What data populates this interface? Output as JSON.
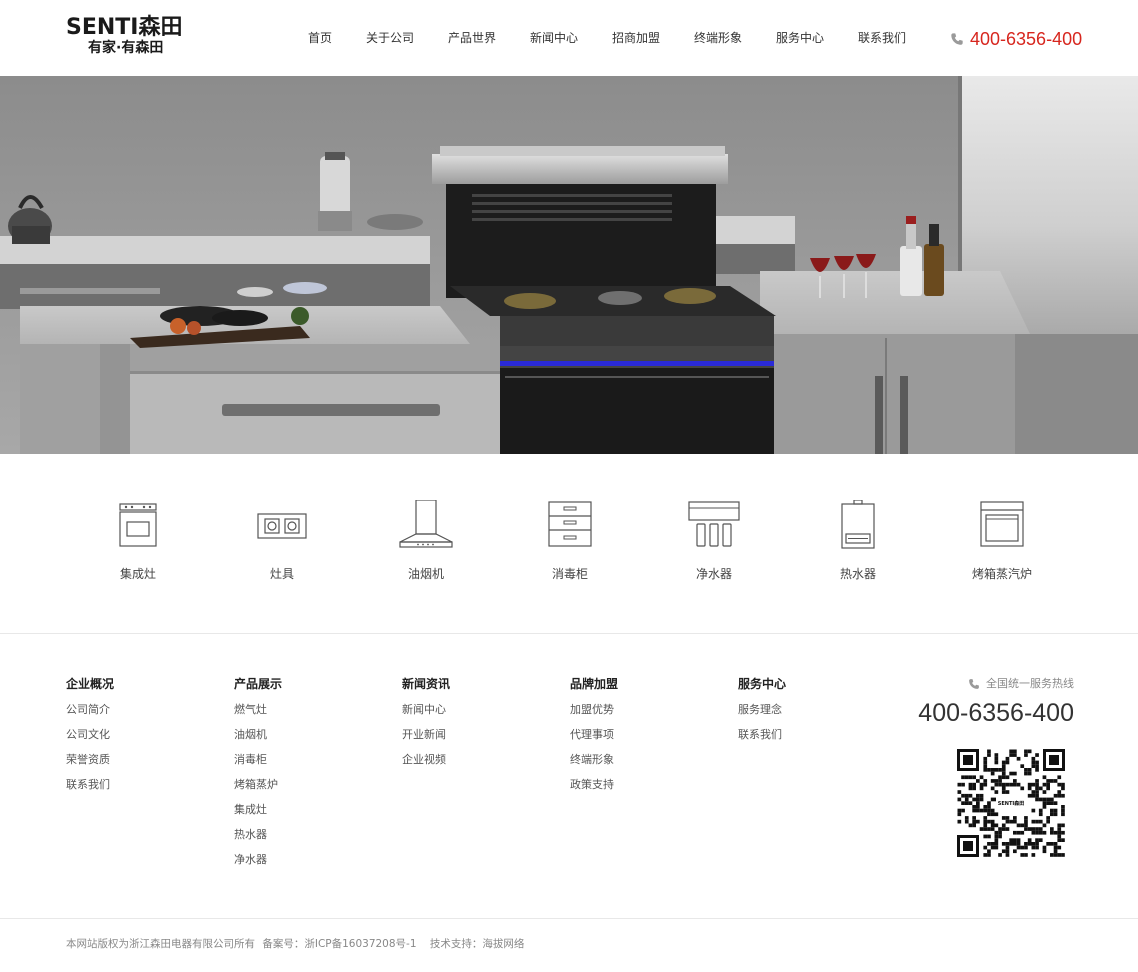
{
  "header": {
    "logo_brand": "SENTI森田",
    "logo_slogan": "有家·有森田",
    "nav": [
      "首页",
      "关于公司",
      "产品世界",
      "新闻中心",
      "招商加盟",
      "终端形象",
      "服务中心",
      "联系我们"
    ],
    "phone": "400-6356-400"
  },
  "categories": [
    "集成灶",
    "灶具",
    "油烟机",
    "消毒柜",
    "净水器",
    "热水器",
    "烤箱蒸汽炉"
  ],
  "footer": {
    "columns": [
      {
        "title": "企业概况",
        "links": [
          "公司简介",
          "公司文化",
          "荣誉资质",
          "联系我们"
        ]
      },
      {
        "title": "产品展示",
        "links": [
          "燃气灶",
          "油烟机",
          "消毒柜",
          "烤箱蒸炉",
          "集成灶",
          "热水器",
          "净水器"
        ]
      },
      {
        "title": "新闻资讯",
        "links": [
          "新闻中心",
          "开业新闻",
          "企业视频"
        ]
      },
      {
        "title": "品牌加盟",
        "links": [
          "加盟优势",
          "代理事项",
          "终端形象",
          "政策支持"
        ]
      },
      {
        "title": "服务中心",
        "links": [
          "服务理念",
          "联系我们"
        ]
      }
    ],
    "hotline_label": "全国统一服务热线",
    "hotline_number": "400-6356-400",
    "qr_label": "SENTI森田",
    "copyright": "本网站版权为浙江森田电器有限公司所有",
    "icp": "备案号：浙ICP备16037208号-1",
    "support": "技术支持：海拔网络"
  },
  "colors": {
    "accent": "#d7261e",
    "text": "#333333",
    "muted": "#888888"
  }
}
